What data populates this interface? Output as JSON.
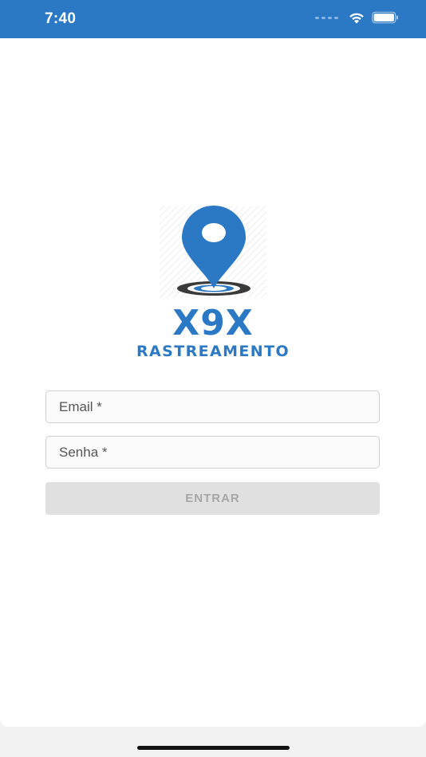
{
  "status_bar": {
    "time": "7:40",
    "background": "#2b78c5",
    "icons": [
      "signal-icon",
      "wifi-icon",
      "battery-icon"
    ]
  },
  "logo": {
    "title": "X9X",
    "subtitle": "RASTREAMENTO",
    "icon": "map-pin-icon",
    "color": "#2b78c5"
  },
  "form": {
    "email_placeholder": "Email *",
    "password_placeholder": "Senha *",
    "submit_label": "ENTRAR",
    "submit_enabled": false
  }
}
